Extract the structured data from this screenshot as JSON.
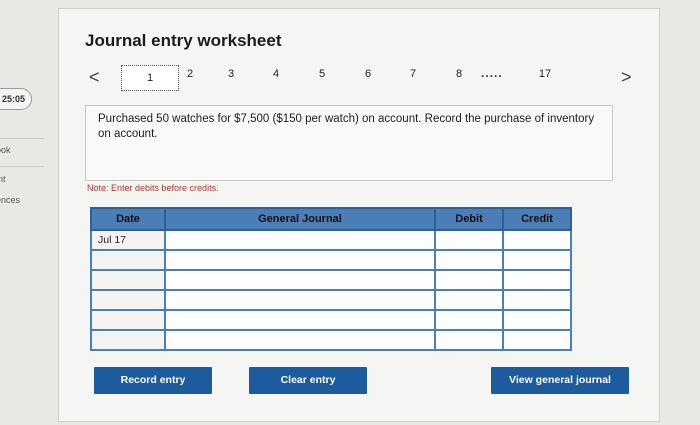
{
  "sidebar": {
    "timer": "25:05",
    "links": [
      "ook",
      "int",
      "ences"
    ]
  },
  "worksheet": {
    "title": "Journal entry worksheet",
    "pager": {
      "prev": "<",
      "next": ">",
      "pages": [
        "1",
        "2",
        "3",
        "4",
        "5",
        "6",
        "7",
        "8"
      ],
      "ellipsis": ".....",
      "last": "17",
      "current": "1"
    },
    "question": "Purchased 50 watches for $7,500 ($150 per watch) on account. Record the purchase of inventory on account.",
    "note": "Note: Enter debits before credits.",
    "table": {
      "headers": {
        "date": "Date",
        "general_journal": "General Journal",
        "debit": "Debit",
        "credit": "Credit"
      },
      "rows": [
        {
          "date": "Jul 17",
          "account": "",
          "debit": "",
          "credit": ""
        },
        {
          "date": "",
          "account": "",
          "debit": "",
          "credit": ""
        },
        {
          "date": "",
          "account": "",
          "debit": "",
          "credit": ""
        },
        {
          "date": "",
          "account": "",
          "debit": "",
          "credit": ""
        },
        {
          "date": "",
          "account": "",
          "debit": "",
          "credit": ""
        },
        {
          "date": "",
          "account": "",
          "debit": "",
          "credit": ""
        }
      ]
    },
    "buttons": {
      "record": "Record entry",
      "clear": "Clear entry",
      "view": "View general journal"
    }
  }
}
